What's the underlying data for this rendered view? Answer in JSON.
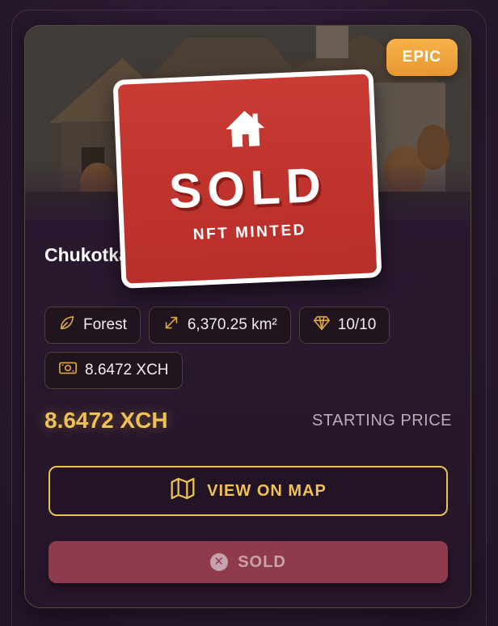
{
  "card": {
    "rarity": "EPIC",
    "title": "Chukotka Forest Territory 961",
    "chips": [
      {
        "icon": "leaf-icon",
        "label": "Forest"
      },
      {
        "icon": "resize-arrows-icon",
        "label": "6,370.25 km²"
      },
      {
        "icon": "diamond-icon",
        "label": "10/10"
      },
      {
        "icon": "money-icon",
        "label": "8.6472 XCH"
      }
    ],
    "price": "8.6472 XCH",
    "price_label": "STARTING PRICE",
    "map_button_label": "VIEW ON MAP",
    "sold_button_label": "SOLD"
  },
  "overlay": {
    "sold_label": "SOLD",
    "minted_label": "NFT MINTED"
  },
  "colors": {
    "accent_gold": "#f0c253",
    "rarity_orange": "#f2a83c",
    "sold_red": "#c23530",
    "button_disabled": "#8f3a4d"
  }
}
